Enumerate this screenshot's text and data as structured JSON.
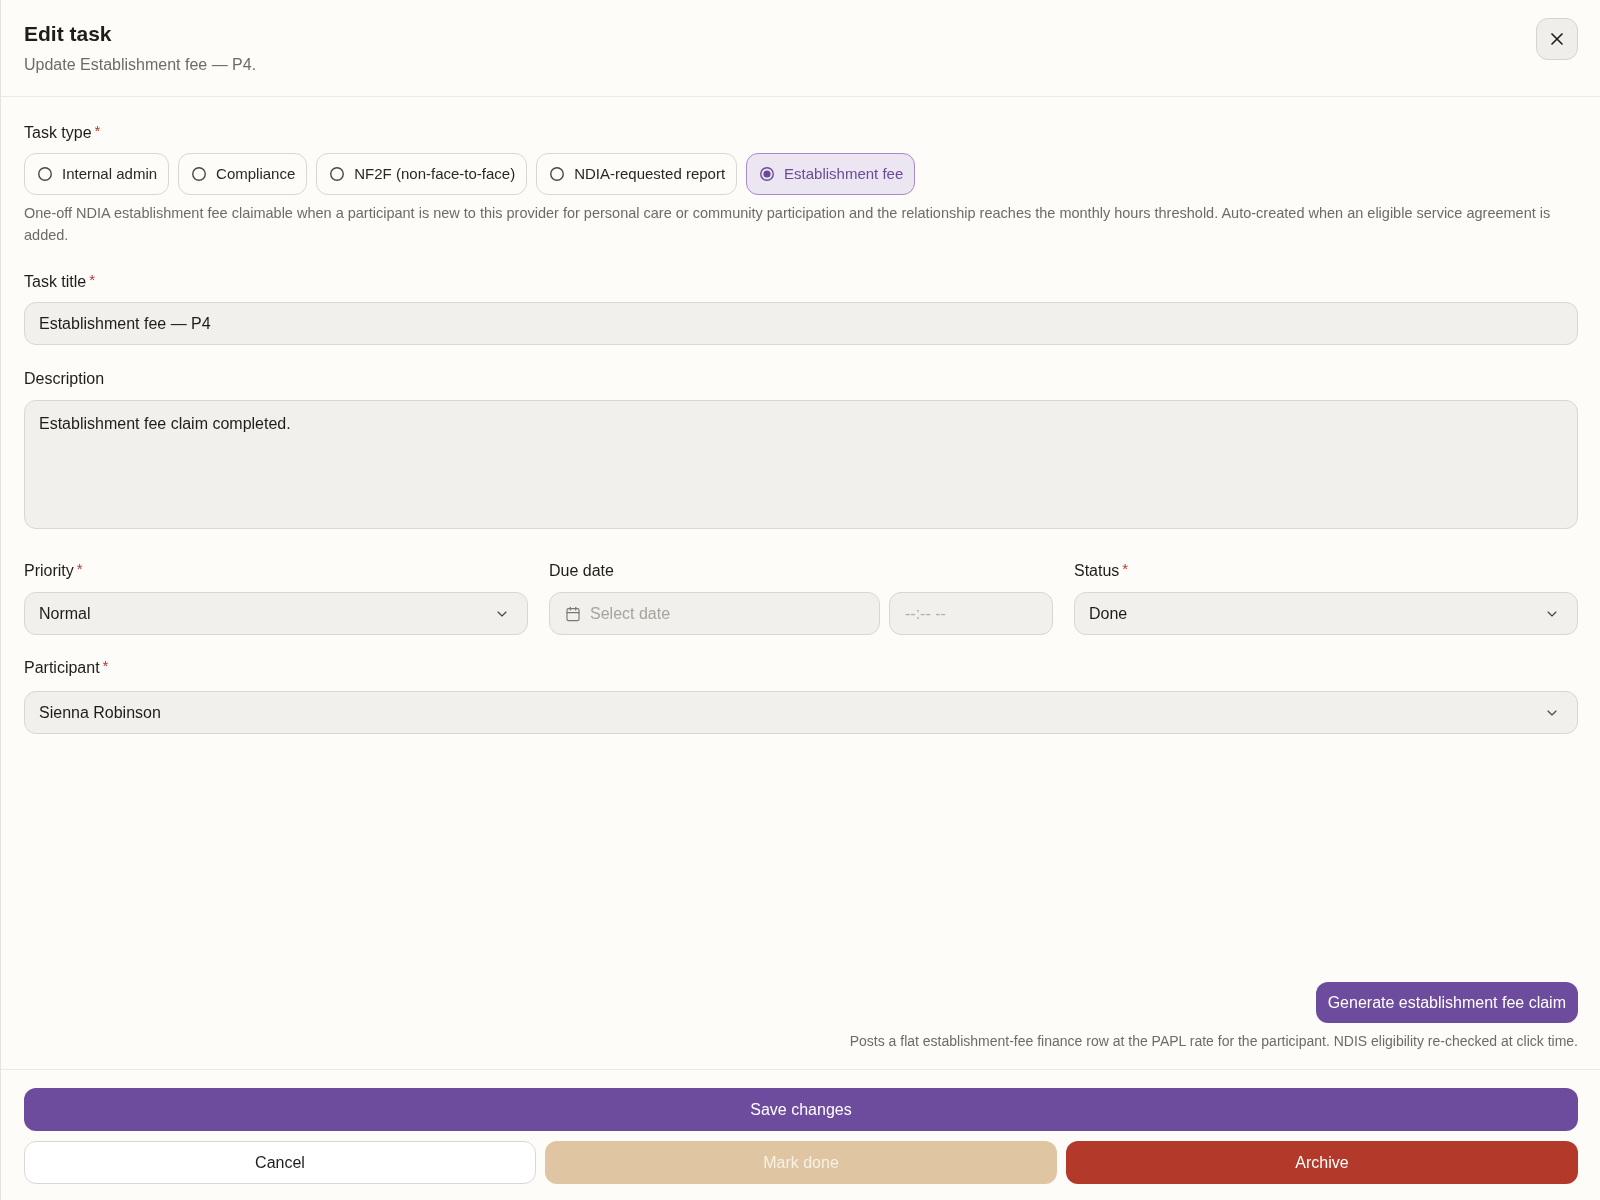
{
  "dialog": {
    "title": "Edit task",
    "subtitle": "Update Establishment fee — P4."
  },
  "task_type": {
    "label": "Task type",
    "required_mark": "*",
    "options": [
      {
        "label": "Internal admin",
        "selected": false
      },
      {
        "label": "Compliance",
        "selected": false
      },
      {
        "label": "NF2F (non-face-to-face)",
        "selected": false
      },
      {
        "label": "NDIA-requested report",
        "selected": false
      },
      {
        "label": "Establishment fee",
        "selected": true
      }
    ],
    "help": "One-off NDIA establishment fee claimable when a participant is new to this provider for personal care or community participation and the relationship reaches the monthly hours threshold. Auto-created when an eligible service agreement is added."
  },
  "task_title": {
    "label": "Task title",
    "required_mark": "*",
    "value": "Establishment fee — P4"
  },
  "description": {
    "label": "Description",
    "value": "Establishment fee claim completed."
  },
  "priority": {
    "label": "Priority",
    "required_mark": "*",
    "value": "Normal"
  },
  "due_date": {
    "label": "Due date",
    "date": {
      "placeholder": "Select date"
    },
    "time": {
      "placeholder": "--:-- --"
    }
  },
  "status": {
    "label": "Status",
    "required_mark": "*",
    "value": "Done"
  },
  "participant": {
    "label": "Participant",
    "required_mark": "*",
    "value": "Sienna Robinson"
  },
  "claim": {
    "button": "Generate establishment fee claim",
    "note": "Posts a flat establishment-fee finance row at the PAPL rate for the participant. NDIS eligibility re-checked at click time."
  },
  "footer": {
    "save_button": "Save changes",
    "buttons": [
      {
        "label": "Cancel",
        "kind": "outline",
        "disabled": false
      },
      {
        "label": "Mark done",
        "kind": "accent",
        "disabled": true
      },
      {
        "label": "Archive",
        "kind": "danger",
        "disabled": false
      }
    ]
  }
}
